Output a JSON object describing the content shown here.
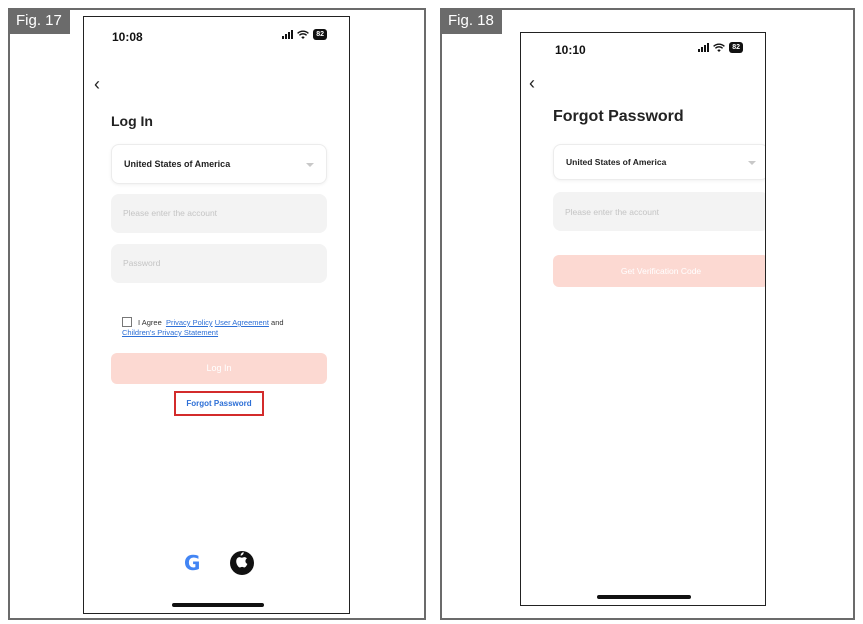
{
  "fig17": {
    "label": "Fig. 17",
    "status": {
      "time": "10:08",
      "battery": "82"
    },
    "title": "Log In",
    "country": "United States of America",
    "account_placeholder": "Please enter the account",
    "password_placeholder": "Password",
    "agree": {
      "prefix": "I Agree",
      "privacy_policy": "Privacy Policy",
      "user_agreement": "User Agreement",
      "and": "and",
      "childrens_statement": "Children's Privacy Statement"
    },
    "login_button": "Log In",
    "forgot_link": "Forgot Password",
    "social": [
      "google-icon",
      "apple-icon"
    ]
  },
  "fig18": {
    "label": "Fig. 18",
    "status": {
      "time": "10:10",
      "battery": "82"
    },
    "title": "Forgot Password",
    "country": "United States of America",
    "account_placeholder": "Please enter the account",
    "verify_button": "Get Verification Code"
  },
  "colors": {
    "accent_disabled": "#fcd9d2",
    "link": "#2d6fd6",
    "highlight": "#d32b2b"
  }
}
